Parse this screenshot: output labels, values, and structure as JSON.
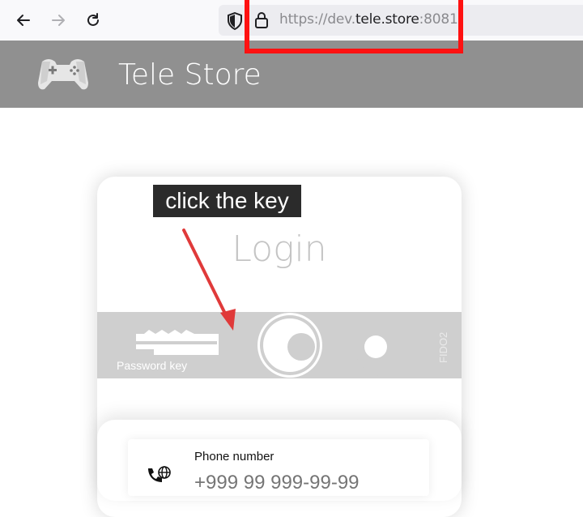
{
  "browser": {
    "url_prefix": "https://dev.",
    "url_domain": "tele.store",
    "url_suffix": ":8081"
  },
  "header": {
    "title": "Tele Store"
  },
  "login": {
    "title": "Login",
    "password_key_label": "Password key",
    "fido_label": "FIDO2"
  },
  "annotation": {
    "tooltip": "click the key",
    "highlight_color": "#ff1111",
    "arrow_color": "#e03a3a"
  },
  "phone": {
    "label": "Phone number",
    "placeholder": "+999 99 999-99-99"
  },
  "icons": [
    "back-arrow-icon",
    "forward-arrow-icon",
    "reload-icon",
    "shield-icon",
    "lock-icon",
    "gamepad-logo-icon",
    "key-icon",
    "phone-globe-icon"
  ]
}
